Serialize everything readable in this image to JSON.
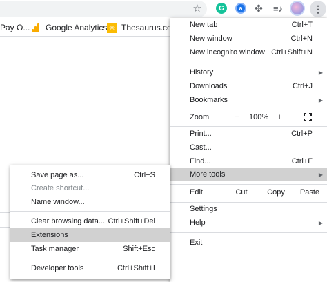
{
  "toolbar": {
    "icons": [
      "star-icon",
      "grammarly-extension-icon",
      "lastpass-extension-icon",
      "extensions-puzzle-icon",
      "media-control-icon",
      "profile-avatar",
      "chrome-menu-kebab-icon"
    ],
    "grammarly_glyph": "G",
    "lastpass_glyph": "a",
    "star_glyph": "☆",
    "puzzle_glyph": "✤",
    "media_glyph": "≡♪",
    "kebab_glyph": "⋮"
  },
  "bookmarks": [
    {
      "label": "Pay O...",
      "icon": "none"
    },
    {
      "label": "Google Analytics",
      "icon": "google-analytics-icon",
      "color": "#f9ab00"
    },
    {
      "label": "Thesaurus.com",
      "icon": "thesaurus-icon",
      "color": "#fbbc04"
    }
  ],
  "main_menu": {
    "new_tab": {
      "label": "New tab",
      "shortcut": "Ctrl+T"
    },
    "new_window": {
      "label": "New window",
      "shortcut": "Ctrl+N"
    },
    "new_incognito": {
      "label": "New incognito window",
      "shortcut": "Ctrl+Shift+N"
    },
    "history": {
      "label": "History"
    },
    "downloads": {
      "label": "Downloads",
      "shortcut": "Ctrl+J"
    },
    "bookmarks": {
      "label": "Bookmarks"
    },
    "zoom": {
      "label": "Zoom",
      "minus": "−",
      "value": "100%",
      "plus": "+"
    },
    "print": {
      "label": "Print...",
      "shortcut": "Ctrl+P"
    },
    "cast": {
      "label": "Cast..."
    },
    "find": {
      "label": "Find...",
      "shortcut": "Ctrl+F"
    },
    "more_tools": {
      "label": "More tools"
    },
    "edit": {
      "label": "Edit",
      "cut": "Cut",
      "copy": "Copy",
      "paste": "Paste"
    },
    "settings": {
      "label": "Settings"
    },
    "help": {
      "label": "Help"
    },
    "exit": {
      "label": "Exit"
    },
    "submenu_arrow": "▶"
  },
  "more_tools_menu": {
    "save_page": {
      "label": "Save page as...",
      "shortcut": "Ctrl+S"
    },
    "create_shortcut": {
      "label": "Create shortcut..."
    },
    "name_window": {
      "label": "Name window..."
    },
    "clear_browsing": {
      "label": "Clear browsing data...",
      "shortcut": "Ctrl+Shift+Del"
    },
    "extensions": {
      "label": "Extensions"
    },
    "task_manager": {
      "label": "Task manager",
      "shortcut": "Shift+Esc"
    },
    "developer_tools": {
      "label": "Developer tools",
      "shortcut": "Ctrl+Shift+I"
    }
  },
  "colors": {
    "highlight": "#d1d1d1",
    "separator": "#dadce0",
    "disabled_text": "#80868b"
  }
}
